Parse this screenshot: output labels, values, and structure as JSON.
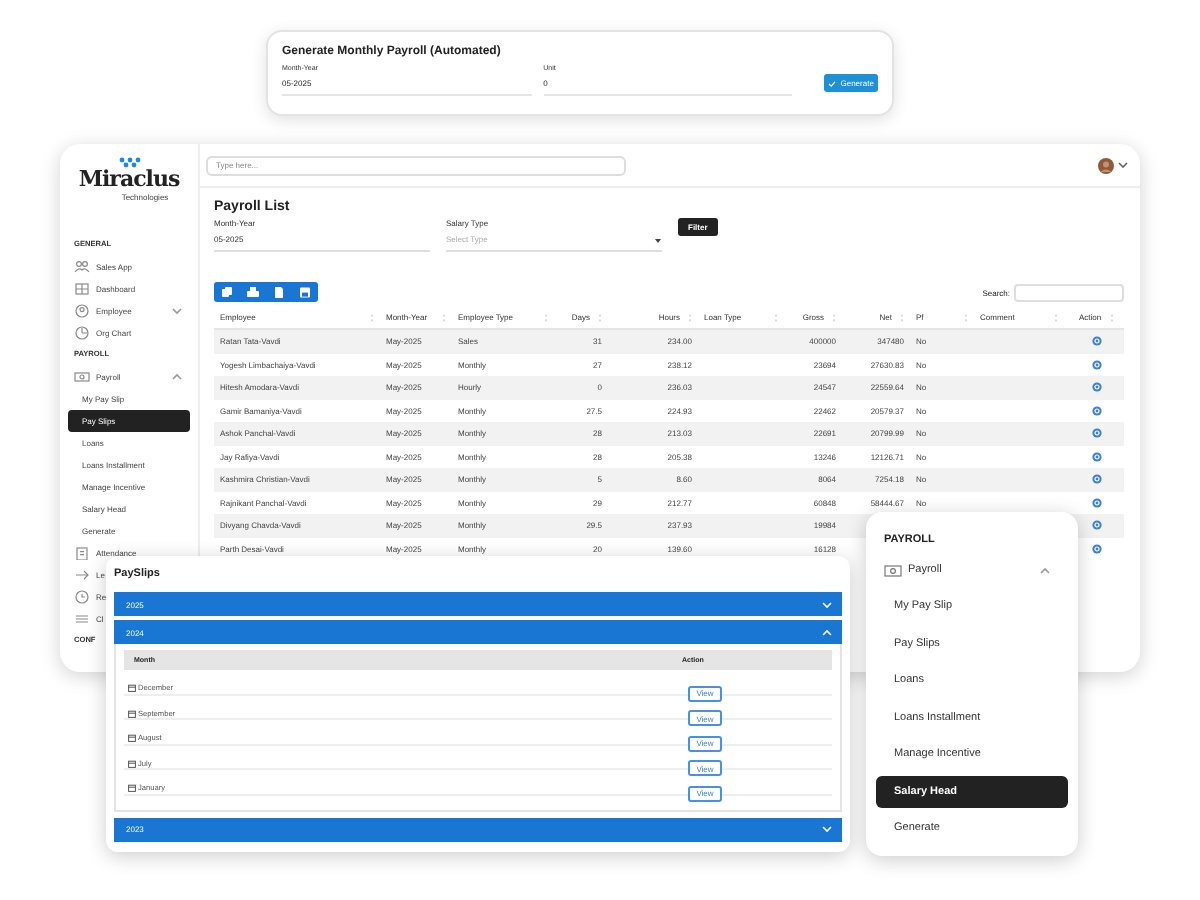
{
  "generate_card": {
    "title": "Generate Monthly Payroll (Automated)",
    "fields": [
      {
        "label": "Month-Year",
        "value": "05-2025"
      },
      {
        "label": "Unit",
        "value": "0"
      }
    ],
    "button": "Generate"
  },
  "topbar": {
    "search": {
      "placeholder": "Type here..."
    }
  },
  "logo": {
    "name": "Miraclus",
    "tagline": "Technologies"
  },
  "sidebar": {
    "sections": [
      {
        "heading": "GENERAL",
        "items": [
          {
            "label": "Sales App",
            "kind": "link",
            "selected": false
          },
          {
            "label": "Dashboard",
            "kind": "link",
            "selected": false
          },
          {
            "label": "Employee",
            "kind": "group",
            "expanded": false,
            "selected": false
          },
          {
            "label": "Org Chart",
            "kind": "link",
            "selected": false
          }
        ]
      },
      {
        "heading": "PAYROLL",
        "items": [
          {
            "label": "Payroll",
            "kind": "group",
            "expanded": true,
            "selected": false
          },
          {
            "label": "My Pay Slip",
            "kind": "sub",
            "selected": false
          },
          {
            "label": "Pay Slips",
            "kind": "sub",
            "selected": true
          },
          {
            "label": "Loans",
            "kind": "sub",
            "selected": false
          },
          {
            "label": "Loans Installment",
            "kind": "sub",
            "selected": false
          },
          {
            "label": "Manage Incentive",
            "kind": "sub",
            "selected": false
          },
          {
            "label": "Salary Head",
            "kind": "sub",
            "selected": false
          },
          {
            "label": "Generate",
            "kind": "sub",
            "selected": false
          },
          {
            "label": "Attendance",
            "kind": "link",
            "selected": false
          },
          {
            "label": "Le",
            "kind": "link",
            "selected": false
          },
          {
            "label": "Re",
            "kind": "link",
            "selected": false
          },
          {
            "label": "Cl",
            "kind": "link",
            "selected": false
          }
        ]
      },
      {
        "heading": "CONF"
      }
    ]
  },
  "payroll_list": {
    "title": "Payroll List",
    "filters": [
      {
        "label": "Month-Year",
        "kind": "text",
        "value": "05-2025"
      },
      {
        "label": "Salary Type",
        "kind": "select",
        "placeholder": "Select Type"
      }
    ],
    "filter_button": "Filter",
    "search_label": "Search:",
    "table": {
      "columns": [
        "Employee",
        "Month-Year",
        "Employee Type",
        "Days",
        "Hours",
        "Loan Type",
        "Gross",
        "Net",
        "Pf",
        "Comment",
        "Action"
      ],
      "rows": [
        {
          "employee": "Ratan Tata-Vavdi",
          "month_year": "May-2025",
          "employee_type": "Sales",
          "days": "31",
          "hours": "234.00",
          "gross": "400000",
          "net": "347480",
          "pf": "No"
        },
        {
          "employee": "Yogesh Limbachaiya-Vavdi",
          "month_year": "May-2025",
          "employee_type": "Monthly",
          "days": "27",
          "hours": "238.12",
          "gross": "23694",
          "net": "27630.83",
          "pf": "No"
        },
        {
          "employee": "Hitesh Amodara-Vavdi",
          "month_year": "May-2025",
          "employee_type": "Hourly",
          "days": "0",
          "hours": "236.03",
          "gross": "24547",
          "net": "22559.64",
          "pf": "No"
        },
        {
          "employee": "Gamir Bamaniya-Vavdi",
          "month_year": "May-2025",
          "employee_type": "Monthly",
          "days": "27.5",
          "hours": "224.93",
          "gross": "22462",
          "net": "20579.37",
          "pf": "No"
        },
        {
          "employee": "Ashok Panchal-Vavdi",
          "month_year": "May-2025",
          "employee_type": "Monthly",
          "days": "28",
          "hours": "213.03",
          "gross": "22691",
          "net": "20799.99",
          "pf": "No"
        },
        {
          "employee": "Jay Rafiya-Vavdi",
          "month_year": "May-2025",
          "employee_type": "Monthly",
          "days": "28",
          "hours": "205.38",
          "gross": "13246",
          "net": "12126.71",
          "pf": "No"
        },
        {
          "employee": "Kashmira Christian-Vavdi",
          "month_year": "May-2025",
          "employee_type": "Monthly",
          "days": "5",
          "hours": "8.60",
          "gross": "8064",
          "net": "7254.18",
          "pf": "No"
        },
        {
          "employee": "Rajnikant Panchal-Vavdi",
          "month_year": "May-2025",
          "employee_type": "Monthly",
          "days": "29",
          "hours": "212.77",
          "gross": "60848",
          "net": "58444.67",
          "pf": "No"
        },
        {
          "employee": "Divyang Chavda-Vavdi",
          "month_year": "May-2025",
          "employee_type": "Monthly",
          "days": "29.5",
          "hours": "237.93",
          "gross": "19984"
        },
        {
          "employee": "Parth Desai-Vavdi",
          "month_year": "May-2025",
          "employee_type": "Monthly",
          "days": "20",
          "hours": "139.60",
          "gross": "16128"
        }
      ]
    }
  },
  "payslips": {
    "title": "PaySlips",
    "years": [
      {
        "label": "2025",
        "expanded": false
      },
      {
        "label": "2024",
        "expanded": true,
        "columns": [
          "Month",
          "Action"
        ],
        "months": [
          {
            "name": "December",
            "button": "View"
          },
          {
            "name": "September",
            "button": "View"
          },
          {
            "name": "August",
            "button": "View"
          },
          {
            "name": "July",
            "button": "View"
          },
          {
            "name": "January",
            "button": "View"
          }
        ]
      },
      {
        "label": "2023",
        "expanded": false
      }
    ]
  },
  "payroll_menu": {
    "heading": "PAYROLL",
    "group": {
      "label": "Payroll",
      "expanded": true
    },
    "items": [
      {
        "label": "My Pay Slip",
        "selected": false
      },
      {
        "label": "Pay Slips",
        "selected": false
      },
      {
        "label": "Loans",
        "selected": false
      },
      {
        "label": "Loans Installment",
        "selected": false
      },
      {
        "label": "Manage Incentive",
        "selected": false
      },
      {
        "label": "Salary Head",
        "selected": true
      },
      {
        "label": "Generate",
        "selected": false
      }
    ]
  }
}
